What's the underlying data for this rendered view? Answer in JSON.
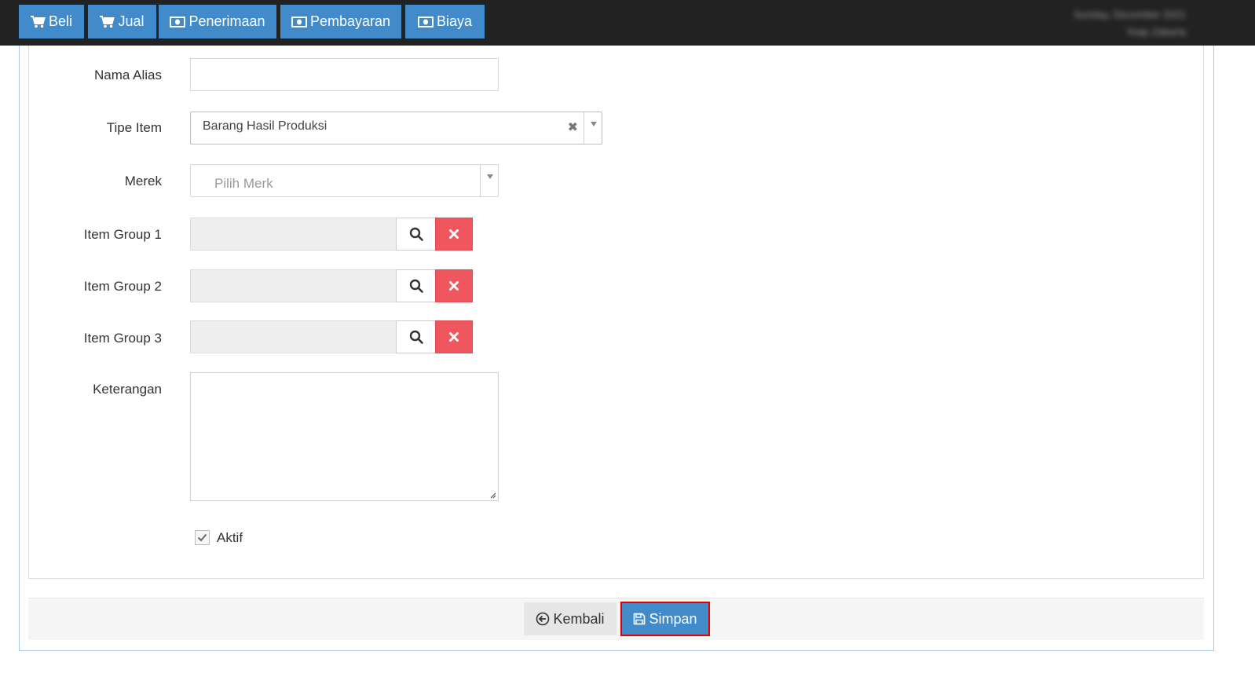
{
  "nav": {
    "items": [
      {
        "label": "Beli",
        "icon": "shopping-cart-icon"
      },
      {
        "label": "Jual",
        "icon": "shopping-cart-icon"
      },
      {
        "label": "Penerimaan",
        "icon": "money-icon"
      },
      {
        "label": "Pembayaran",
        "icon": "money-icon"
      },
      {
        "label": "Biaya",
        "icon": "money-icon"
      }
    ],
    "user_line1": "Sunday, December 2021",
    "user_line2": "Yeap Zakaria"
  },
  "form": {
    "nama_alias": {
      "label": "Nama Alias",
      "value": ""
    },
    "tipe_item": {
      "label": "Tipe Item",
      "value": "Barang Hasil Produksi"
    },
    "merek": {
      "label": "Merek",
      "placeholder": "Pilih Merk"
    },
    "item_group_1": {
      "label": "Item Group 1",
      "value": ""
    },
    "item_group_2": {
      "label": "Item Group 2",
      "value": ""
    },
    "item_group_3": {
      "label": "Item Group 3",
      "value": ""
    },
    "keterangan": {
      "label": "Keterangan",
      "value": ""
    },
    "aktif": {
      "label": "Aktif",
      "checked": true
    }
  },
  "footer": {
    "back_label": "Kembali",
    "save_label": "Simpan"
  },
  "colors": {
    "primary": "#428bca",
    "danger": "#f0565e",
    "topbar": "#222222",
    "highlight": "#e00000"
  }
}
